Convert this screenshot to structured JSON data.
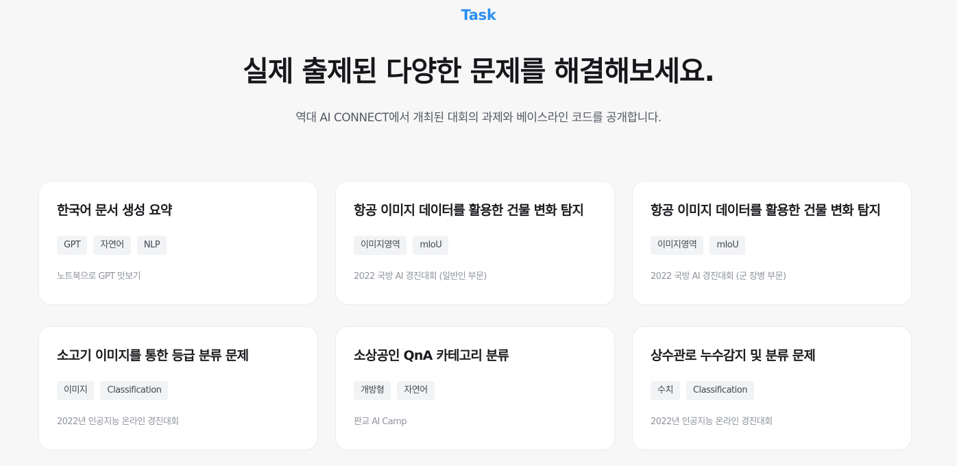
{
  "section": {
    "eyebrow": "Task",
    "headline": "실제 출제된 다양한 문제를 해결해보세요.",
    "subtitle": "역대 AI CONNECT에서 개최된 대회의 과제와 베이스라인 코드를 공개합니다."
  },
  "cards": [
    {
      "title": "한국어 문서 생성 요약",
      "tags": [
        "GPT",
        "자연어",
        "NLP"
      ],
      "meta": "노트북으로 GPT 맛보기"
    },
    {
      "title": "항공 이미지 데이터를 활용한 건물 변화 탐지",
      "tags": [
        "이미지영역",
        "mIoU"
      ],
      "meta": "2022 국방 AI 경진대회 (일반인 부문)"
    },
    {
      "title": "항공 이미지 데이터를 활용한 건물 변화 탐지",
      "tags": [
        "이미지영역",
        "mIoU"
      ],
      "meta": "2022 국방 AI 경진대회 (군 장병 부문)"
    },
    {
      "title": "소고기 이미지를 통한 등급 분류 문제",
      "tags": [
        "이미지",
        "Classification"
      ],
      "meta": "2022년 인공지능 온라인 경진대회"
    },
    {
      "title": "소상공인 QnA 카테고리 분류",
      "tags": [
        "개방형",
        "자연어"
      ],
      "meta": "판교 AI Camp"
    },
    {
      "title": "상수관로 누수감지 및 분류 문제",
      "tags": [
        "수치",
        "Classification"
      ],
      "meta": "2022년 인공지능 온라인 경진대회"
    }
  ],
  "colors": {
    "accent": "#2a8ff0",
    "background": "#f7f7f8",
    "card": "#ffffff",
    "tag_background": "#f2f3f5",
    "meta_text": "#8f949b"
  }
}
